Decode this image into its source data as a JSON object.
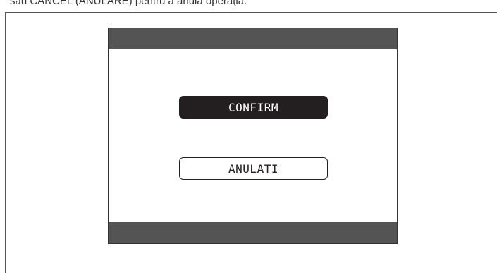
{
  "caption": "sau CANCEL (ANULARE) pentru a anula operaţia.",
  "dialog": {
    "confirm_label": "CONFIRM",
    "cancel_label": "ANULATI"
  },
  "colors": {
    "bar": "#545454",
    "confirm_bg": "#231f20",
    "confirm_text": "#ffffff"
  }
}
